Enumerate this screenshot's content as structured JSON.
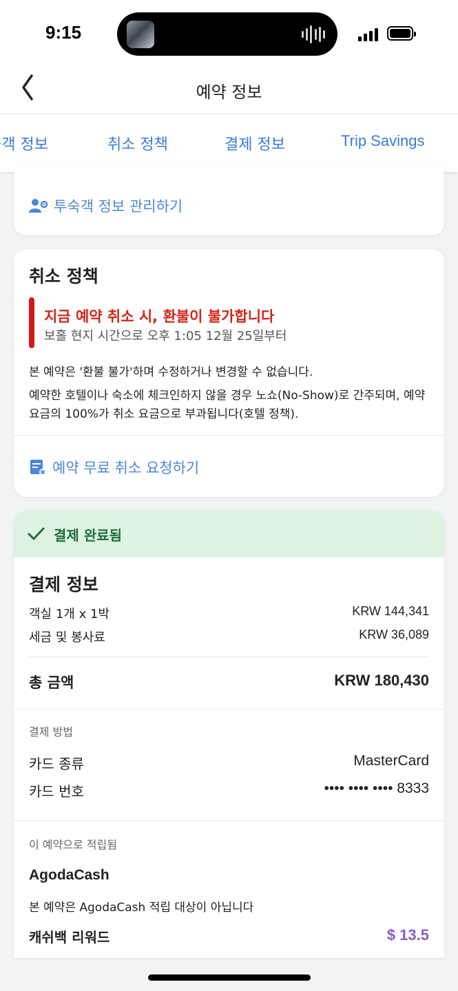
{
  "status_bar": {
    "time": "9:15"
  },
  "header": {
    "title": "예약 정보"
  },
  "tabs": [
    {
      "label": "숙객 정보"
    },
    {
      "label": "취소 정책"
    },
    {
      "label": "결제 정보"
    },
    {
      "label": "Trip Savings"
    }
  ],
  "guests": {
    "manage_link": "투숙객 정보 관리하기"
  },
  "cancellation": {
    "title": "취소 정책",
    "alert_title": "지금 예약 취소 시, 환불이 불가합니다",
    "alert_sub": "보홀 현지 시간으로 오후 1:05 12월 25일부터",
    "text1": "본 예약은 '환불 불가'하며 수정하거나 변경할 수 없습니다.",
    "text2": "예약한 호텔이나 숙소에 체크인하지 않을 경우 노쇼(No-Show)로 간주되며, 예약 요금의 100%가 취소 요금으로 부과됩니다(호텔 정책).",
    "free_cancel_link": "예약 무료 취소 요청하기"
  },
  "payment": {
    "status": "결제 완료됨",
    "title": "결제 정보",
    "room_label": "객실 1개 x 1박",
    "room_value": "KRW 144,341",
    "tax_label": "세금 및 봉사료",
    "tax_value": "KRW 36,089",
    "total_label": "총 금액",
    "total_value": "KRW 180,430",
    "method_header": "결제 방법",
    "card_type_label": "카드 종류",
    "card_type_value": "MasterCard",
    "card_number_label": "카드 번호",
    "card_number_value": "•••• •••• •••• 8333",
    "earned_header": "이 예약으로 적립됨",
    "agodacash_title": "AgodaCash",
    "agodacash_text": "본 예약은 AgodaCash 적립 대상이 아닙니다",
    "cashback_label": "캐쉬백 리워드",
    "cashback_value": "$ 13.5"
  },
  "colors": {
    "accent": "#3a7bd5",
    "alert": "#d32419",
    "success": "#1d6d3a",
    "success_bg": "#def2e2",
    "cashback": "#8b5cc6"
  }
}
